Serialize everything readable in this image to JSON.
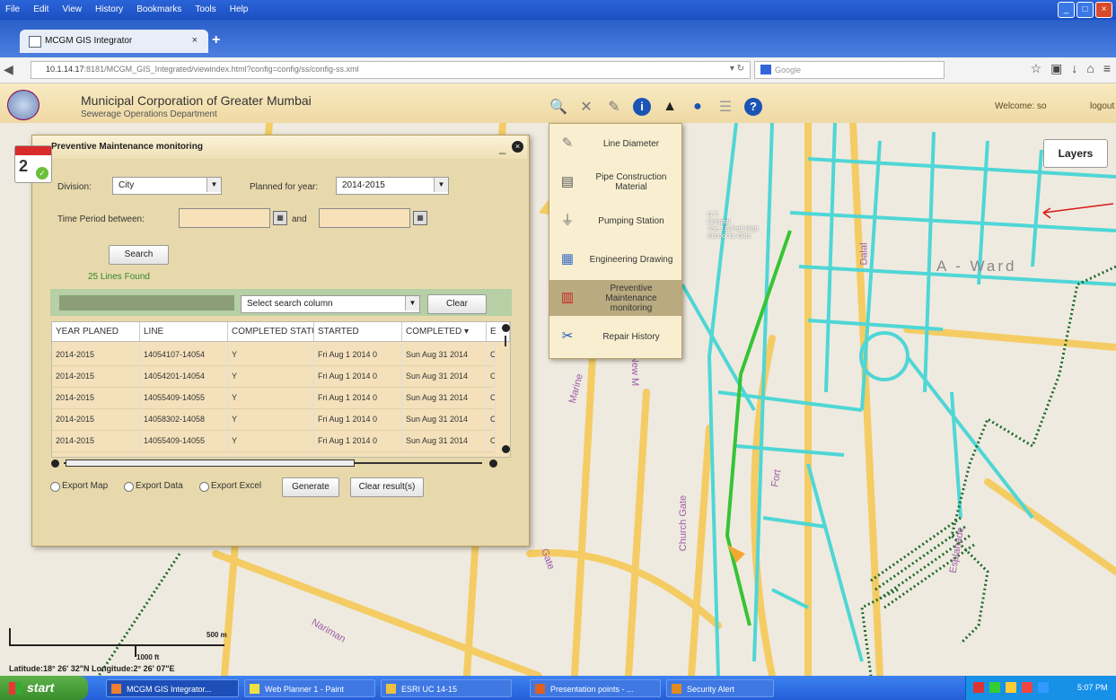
{
  "browser": {
    "menu": [
      "File",
      "Edit",
      "View",
      "History",
      "Bookmarks",
      "Tools",
      "Help"
    ],
    "tab_title": "MCGM GIS Integrator",
    "url_host": "10.1.14.17",
    "url_path": ":8181/MCGM_GIS_Integrated/viewindex.html?config=config/ss/config-ss.xml",
    "search_placeholder": "Google",
    "new_tab": "+",
    "tab_close": "×"
  },
  "app": {
    "title": "Municipal Corporation of Greater Mumbai",
    "subtitle": "Sewerage Operations Department",
    "welcome": "Welcome: so",
    "logout": "logout",
    "toolbar_icons": [
      "magnify-icon",
      "tools-icon",
      "edit-icon",
      "info-icon",
      "north-arrow-icon",
      "globe-icon",
      "list-icon",
      "help-icon"
    ]
  },
  "map": {
    "layers_button": "Layers",
    "ward_label": "A - Ward",
    "streets": [
      "Marine",
      "New M",
      "Church Gate",
      "Fort",
      "Gate",
      "Nariman",
      "Esplanade",
      "Dalal"
    ],
    "poi": [
      "G.T.",
      "Hospital",
      "The J.B.Petit High",
      "School for Girls"
    ],
    "scale_m": "500 m",
    "scale_ft": "1000 ft",
    "coordinates": "Latitude:18° 26' 32\"N  Longitude:2° 26' 07\"E"
  },
  "layer_menu": [
    {
      "label": "Line Diameter",
      "icon": "line-diameter-icon",
      "selected": false
    },
    {
      "label": "Pipe Construction Material",
      "icon": "pipe-material-icon",
      "selected": false
    },
    {
      "label": "Pumping Station",
      "icon": "pumping-station-icon",
      "selected": false
    },
    {
      "label": "Engineering Drawing",
      "icon": "engineering-drawing-icon",
      "selected": false
    },
    {
      "label": "Preventive Maintenance monitoring",
      "icon": "calendar-icon",
      "selected": true
    },
    {
      "label": "Repair History",
      "icon": "repair-icon",
      "selected": false
    }
  ],
  "panel": {
    "title": "Preventive Maintenance monitoring",
    "minimize": "_",
    "close": "×",
    "badge_day": "2",
    "division_label": "Division:",
    "division_value": "City",
    "year_label": "Planned for year:",
    "year_value": "2014-2015",
    "period_label": "Time Period between:",
    "and_label": "and",
    "search_button": "Search",
    "found_text": "25 Lines Found",
    "search_column_placeholder": "Select search column",
    "clear_button": "Clear",
    "columns": [
      "YEAR PLANED",
      "LINE",
      "COMPLETED STATUS",
      "STARTED",
      "COMPLETED ▾",
      "E"
    ],
    "rows": [
      [
        "2014-2015",
        "14054107-14054",
        "Y",
        "Fri Aug 1 2014 0",
        "Sun Aug 31 2014",
        "C"
      ],
      [
        "2014-2015",
        "14054201-14054",
        "Y",
        "Fri Aug 1 2014 0",
        "Sun Aug 31 2014",
        "C"
      ],
      [
        "2014-2015",
        "14055409-14055",
        "Y",
        "Fri Aug 1 2014 0",
        "Sun Aug 31 2014",
        "C"
      ],
      [
        "2014-2015",
        "14058302-14058",
        "Y",
        "Fri Aug 1 2014 0",
        "Sun Aug 31 2014",
        "C"
      ],
      [
        "2014-2015",
        "14055409-14055",
        "Y",
        "Fri Aug 1 2014 0",
        "Sun Aug 31 2014",
        "C"
      ]
    ],
    "export_map": "Export Map",
    "export_data": "Export Data",
    "export_excel": "Export Excel",
    "generate_button": "Generate",
    "clear_results_button": "Clear result(s)"
  },
  "taskbar": {
    "start": "start",
    "tasks": [
      "MCGM GIS Integrator...",
      "Web Planner 1 - Paint",
      "ESRI UC 14-15",
      "Presentation points - ...",
      "Security Alert"
    ],
    "clock": "5:07 PM"
  },
  "colors": {
    "sewer_line": "#4fd6d6",
    "highlight_line": "#35c435",
    "ward_boundary": "#1c6a2a",
    "road": "#f7d26b",
    "panel_bg": "#e8d9ac"
  }
}
